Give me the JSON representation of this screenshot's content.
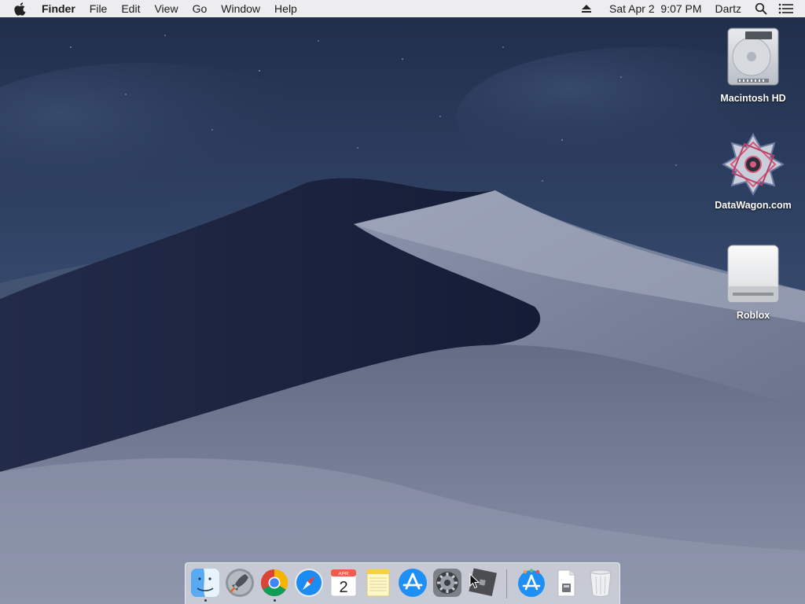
{
  "menubar": {
    "app_name": "Finder",
    "menus": [
      "File",
      "Edit",
      "View",
      "Go",
      "Window",
      "Help"
    ],
    "datetime": "Sat Apr 2  9:07 PM",
    "user": "Dartz"
  },
  "desktop_icons": [
    {
      "label": "Macintosh HD",
      "icon": "hard-drive-icon"
    },
    {
      "label": "DataWagon.com",
      "icon": "datawagon-disk-icon"
    },
    {
      "label": "Roblox",
      "icon": "external-disk-icon"
    }
  ],
  "dock": {
    "apps": [
      {
        "name": "finder",
        "icon": "finder-icon",
        "running": true
      },
      {
        "name": "launchpad",
        "icon": "launchpad-icon",
        "running": false
      },
      {
        "name": "chrome",
        "icon": "chrome-icon",
        "running": true
      },
      {
        "name": "safari",
        "icon": "safari-icon",
        "running": false
      },
      {
        "name": "calendar",
        "icon": "calendar-icon",
        "running": false,
        "month": "APR",
        "day": "2"
      },
      {
        "name": "notes",
        "icon": "notes-icon",
        "running": false
      },
      {
        "name": "app-store",
        "icon": "app-store-icon",
        "running": false
      },
      {
        "name": "system-preferences",
        "icon": "system-preferences-icon",
        "running": false
      },
      {
        "name": "roblox-studio",
        "icon": "roblox-studio-icon",
        "running": false
      }
    ],
    "right": [
      {
        "name": "app-store-downloads",
        "icon": "app-store-folder-icon"
      },
      {
        "name": "documents-stack",
        "icon": "document-stack-icon"
      },
      {
        "name": "trash",
        "icon": "trash-icon"
      }
    ]
  },
  "colors": {
    "sky": "#2c3d5e",
    "dune_light": "#8b93aa",
    "dune_dark": "#1b2340",
    "menubar": "#f6f6f6"
  }
}
